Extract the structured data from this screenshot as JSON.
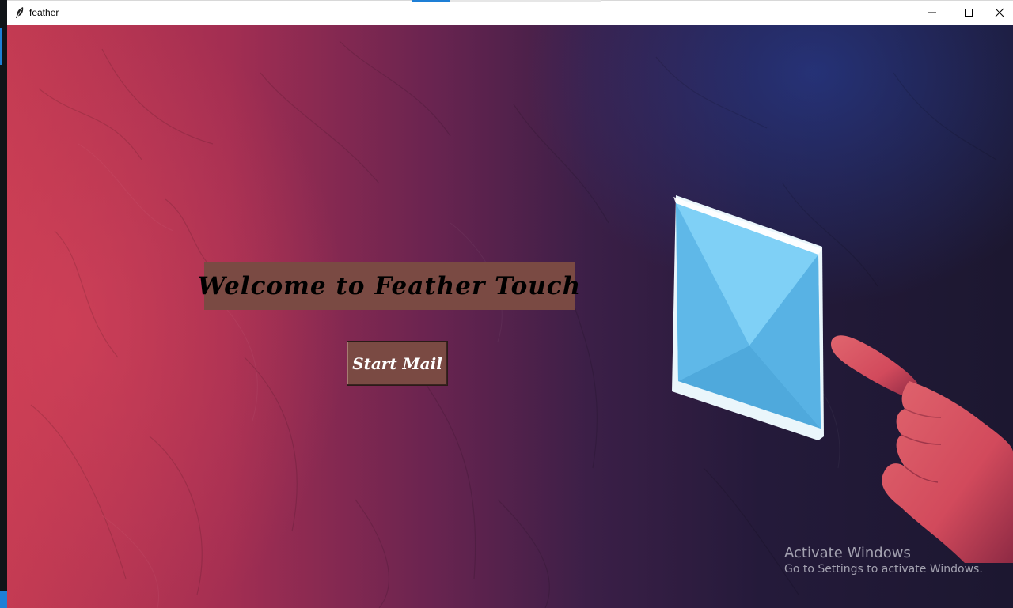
{
  "window": {
    "title": "feather",
    "app_icon": "feather-icon",
    "controls": {
      "minimize_icon": "minimize-icon",
      "maximize_icon": "maximize-icon",
      "close_icon": "close-icon"
    }
  },
  "main": {
    "welcome_text": "Welcome to Feather Touch",
    "start_button_label": "Start Mail",
    "illustration": {
      "envelope_icon": "envelope-icon",
      "hand_icon": "pointing-hand-icon"
    },
    "colors": {
      "banner_bg": "#7a4a43",
      "button_bg": "#7a4a43",
      "envelope": "#6ec6f2",
      "background_left": "#c23a52",
      "background_right": "#1c1730"
    }
  },
  "watermark": {
    "title": "Activate Windows",
    "subtitle": "Go to Settings to activate Windows."
  }
}
